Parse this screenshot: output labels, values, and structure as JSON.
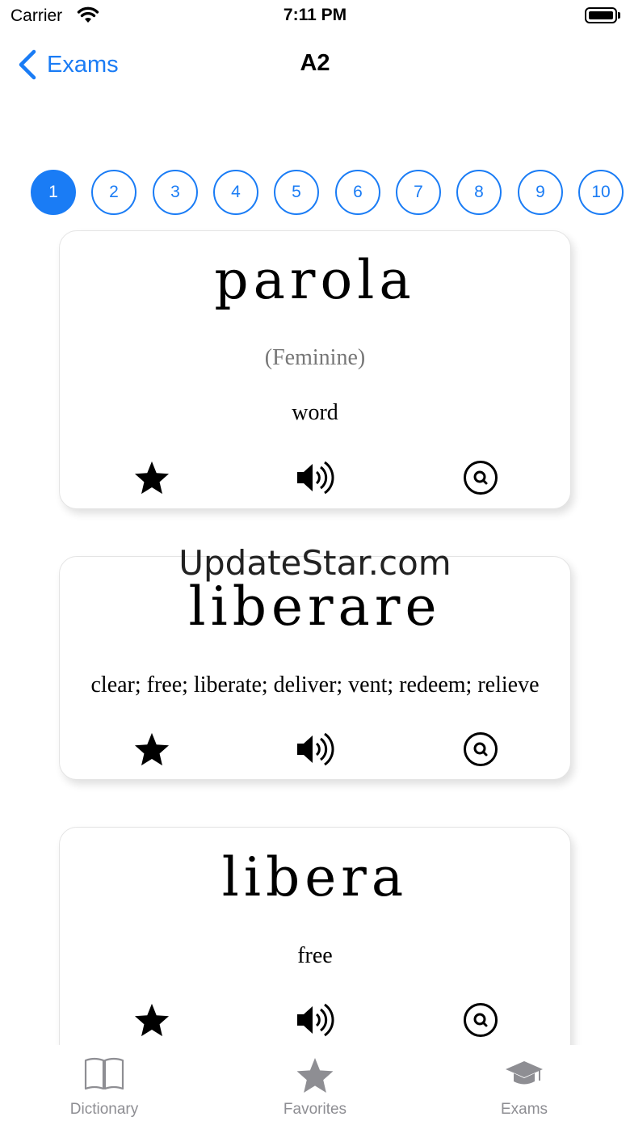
{
  "status_bar": {
    "carrier": "Carrier",
    "time": "7:11 PM"
  },
  "nav": {
    "back_label": "Exams",
    "title": "A2"
  },
  "pagination": {
    "pages": [
      "1",
      "2",
      "3",
      "4",
      "5",
      "6",
      "7",
      "8",
      "9",
      "10"
    ],
    "selected": "1"
  },
  "cards": [
    {
      "word": "parola",
      "gender": "(Feminine)",
      "meaning": "word"
    },
    {
      "word": "liberare",
      "meaning": "clear; free; liberate; deliver; vent; redeem; relieve"
    },
    {
      "word": "libera",
      "meaning": "free"
    }
  ],
  "watermark": "UpdateStar.com",
  "tab_bar": {
    "tabs": [
      {
        "label": "Dictionary",
        "icon": "book-icon"
      },
      {
        "label": "Favorites",
        "icon": "star-icon"
      },
      {
        "label": "Exams",
        "icon": "graduation-cap-icon"
      }
    ]
  },
  "colors": {
    "accent": "#1a7cf5",
    "tab_inactive": "#8e8e93"
  }
}
